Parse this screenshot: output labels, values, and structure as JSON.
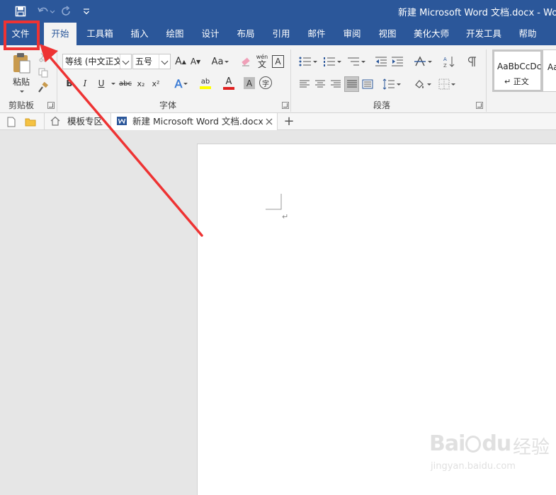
{
  "window": {
    "title": "新建 Microsoft Word 文档.docx - Wo"
  },
  "ribbon": {
    "tabs": [
      "文件",
      "开始",
      "工具箱",
      "插入",
      "绘图",
      "设计",
      "布局",
      "引用",
      "邮件",
      "审阅",
      "视图",
      "美化大师",
      "开发工具",
      "帮助"
    ],
    "clipboard": {
      "paste_label": "粘贴",
      "group_label": "剪贴板"
    },
    "font": {
      "font_name": "等线 (中文正文",
      "font_size": "五号",
      "group_label": "字体",
      "grow": "A",
      "shrink": "A",
      "case": "Aa",
      "phonetic_top": "wén",
      "phonetic_bottom": "文",
      "border_char": "A",
      "bold": "B",
      "italic": "I",
      "underline": "U",
      "strike": "abc",
      "subscript": "x₂",
      "superscript": "x²",
      "effects": "A",
      "highlight_text": "ab",
      "font_color": "A",
      "shading_char": "A",
      "circle_char": "字"
    },
    "paragraph": {
      "group_label": "段落"
    },
    "styles": {
      "normal_preview": "AaBbCcDc",
      "normal_name": "正文",
      "next_preview": "Aa"
    }
  },
  "doc_tabs": {
    "template": "模板专区",
    "document": "新建 Microsoft Word 文档.docx",
    "add": "+"
  },
  "document": {
    "paragraph_mark": "↵"
  },
  "watermark": {
    "brand": "Bai",
    "brand2": "du",
    "cn": "经验",
    "url": "jingyan.baidu.com"
  },
  "colors": {
    "brand": "#2b579a",
    "annotation": "#ee3333",
    "font_color_bar": "#e02020",
    "highlight_bar": "#ffff00"
  },
  "icons": [
    "save-icon",
    "undo-icon",
    "redo-icon",
    "customize-qat-icon",
    "paste-icon",
    "cut-icon",
    "copy-icon",
    "format-painter-icon",
    "clear-format-icon",
    "bullets-icon",
    "numbering-icon",
    "multilevel-list-icon",
    "decrease-indent-icon",
    "increase-indent-icon",
    "sort-icon",
    "show-marks-icon",
    "align-left-icon",
    "align-center-icon",
    "align-right-icon",
    "justify-icon",
    "distribute-icon",
    "line-spacing-icon",
    "shading-icon",
    "borders-icon",
    "new-doc-icon",
    "folder-icon",
    "home-icon",
    "word-icon",
    "close-icon"
  ]
}
